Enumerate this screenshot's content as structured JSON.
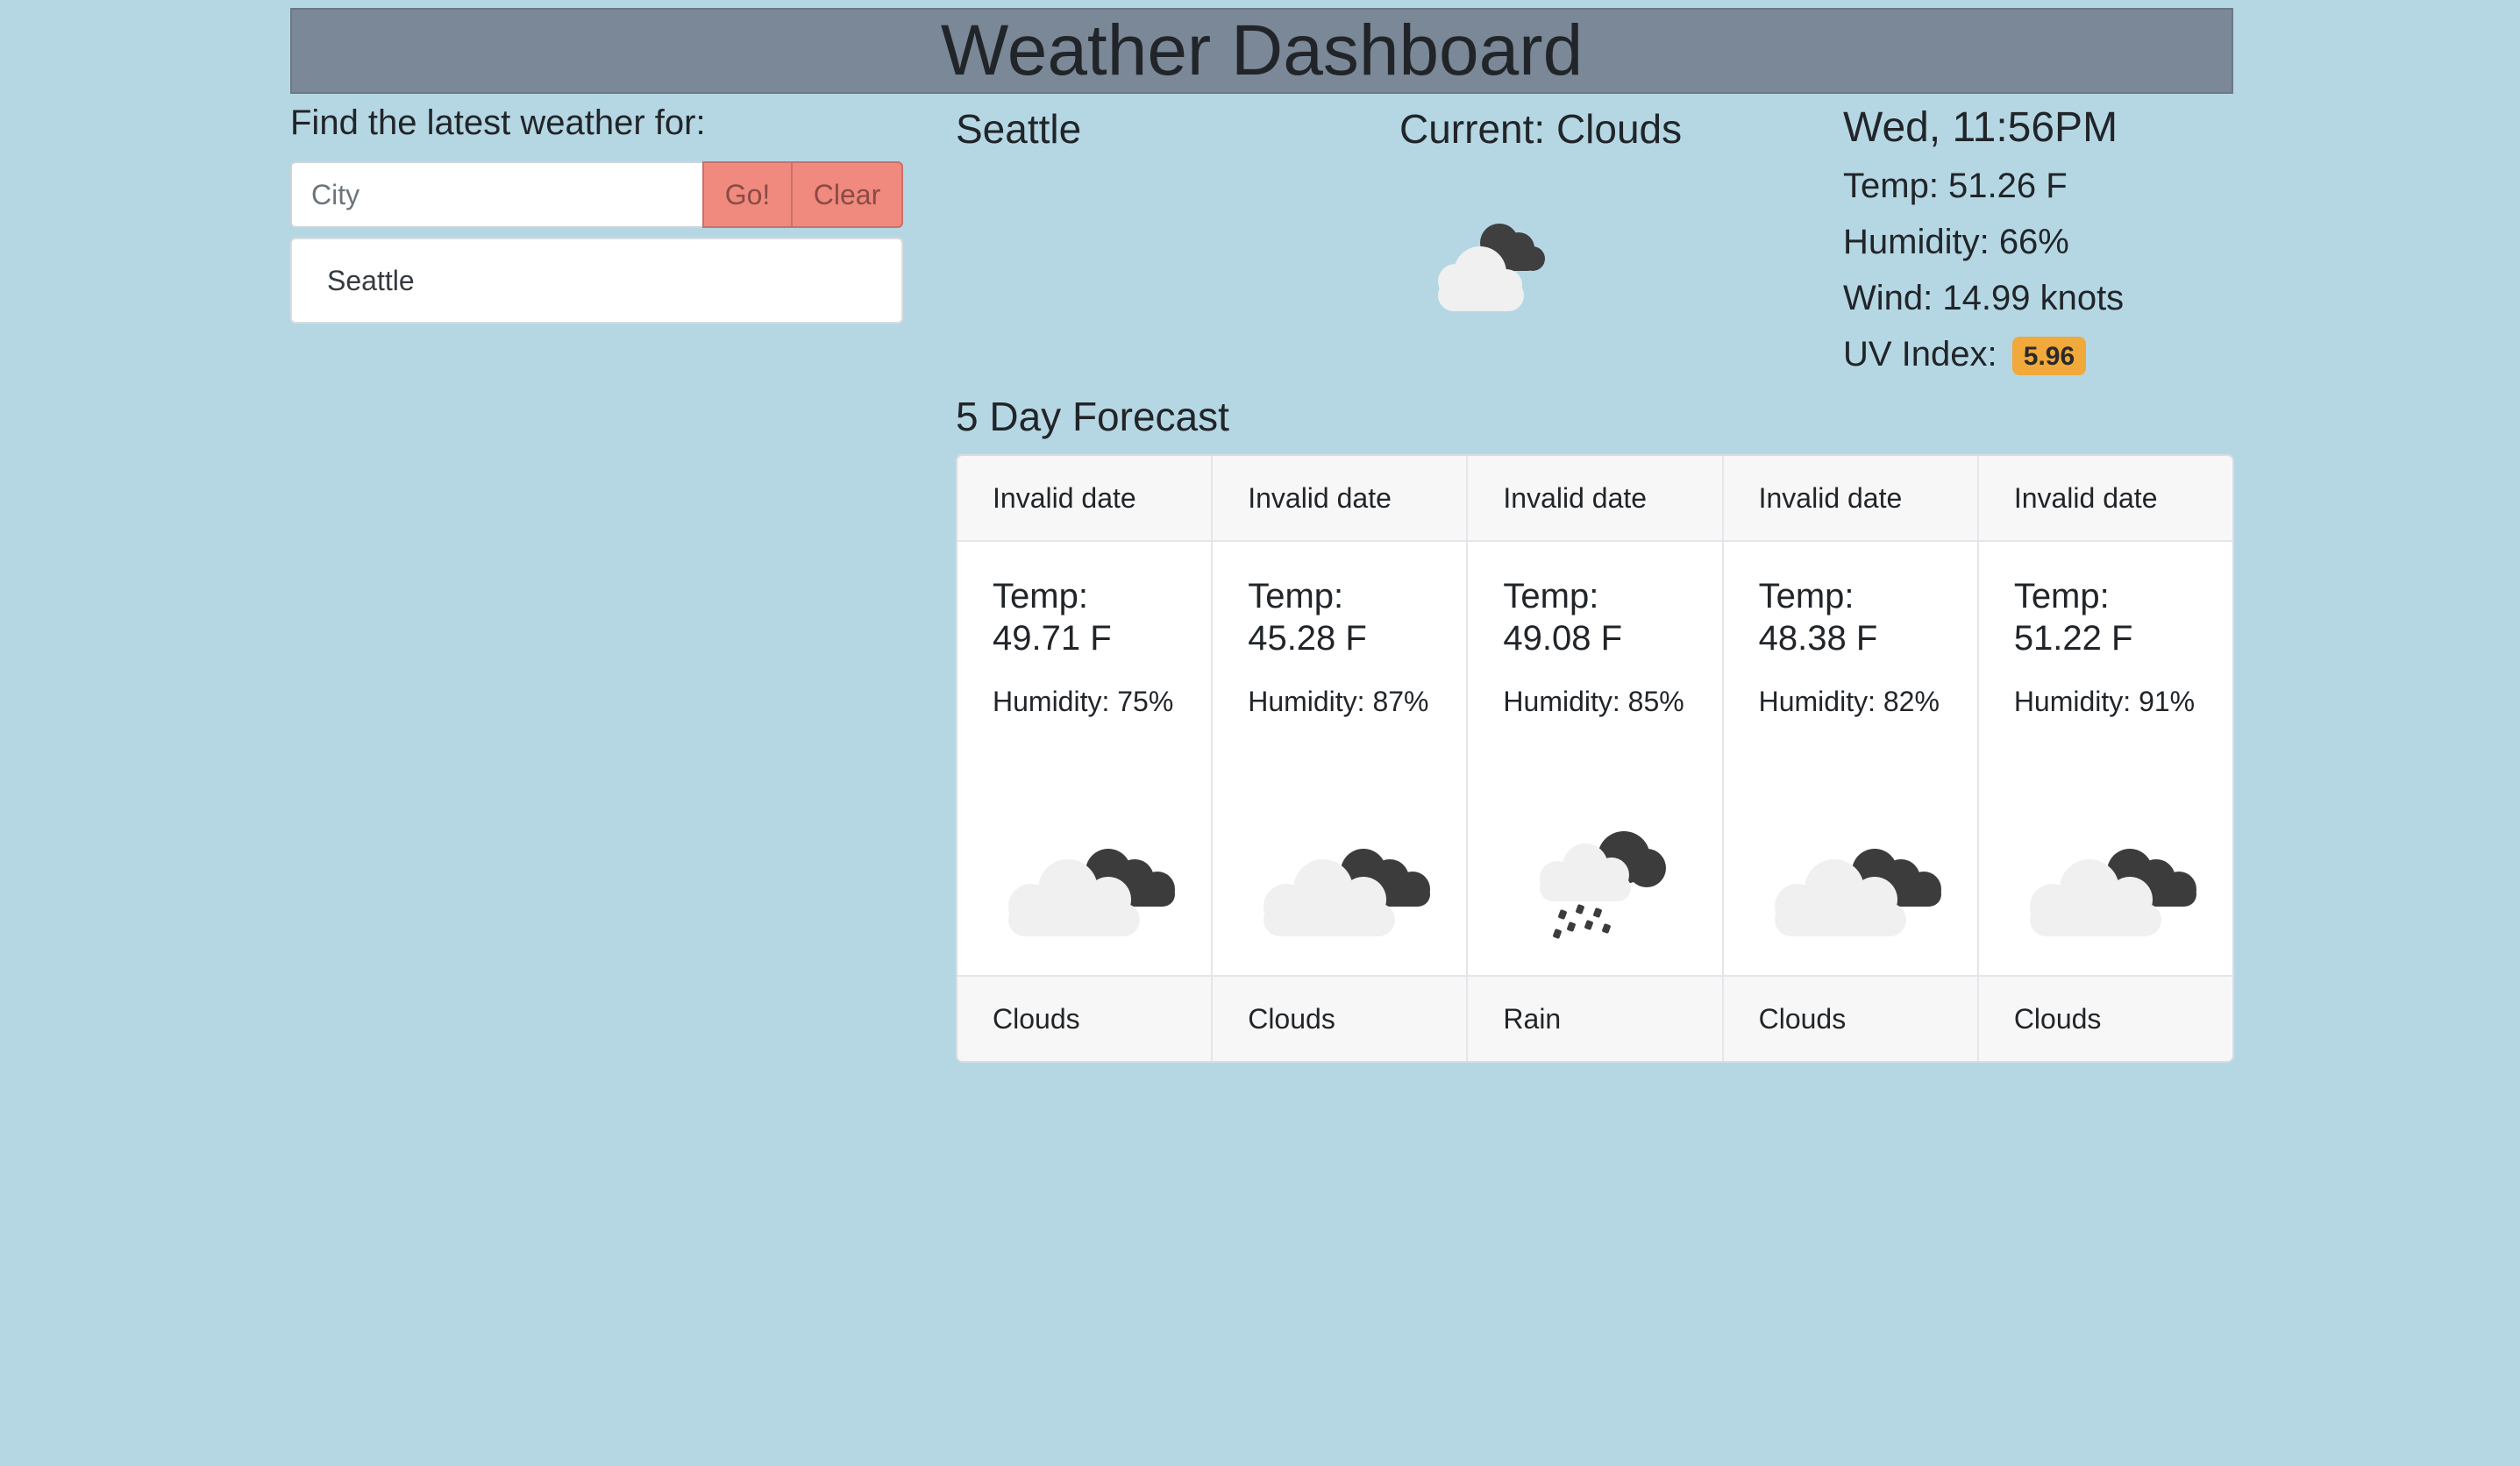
{
  "header": {
    "title": "Weather Dashboard"
  },
  "search": {
    "label": "Find the latest weather for:",
    "placeholder": "City",
    "go_label": "Go!",
    "clear_label": "Clear",
    "history": [
      "Seattle"
    ]
  },
  "current": {
    "city": "Seattle",
    "condition": "Current: Clouds",
    "icon": "clouds-icon",
    "datetime": "Wed, 11:56PM",
    "temp": "Temp: 51.26 F",
    "humidity": "Humidity: 66%",
    "wind": "Wind: 14.99 knots",
    "uv_label": "UV Index:",
    "uv_value": "5.96",
    "uv_color": "#f0a93a"
  },
  "forecast": {
    "title": "5 Day Forecast",
    "days": [
      {
        "date": "Invalid date",
        "temp_label": "Temp:",
        "temp": "49.71 F",
        "humidity": "Humidity: 75%",
        "icon": "clouds-icon",
        "condition": "Clouds"
      },
      {
        "date": "Invalid date",
        "temp_label": "Temp:",
        "temp": "45.28 F",
        "humidity": "Humidity: 87%",
        "icon": "clouds-icon",
        "condition": "Clouds"
      },
      {
        "date": "Invalid date",
        "temp_label": "Temp:",
        "temp": "49.08 F",
        "humidity": "Humidity: 85%",
        "icon": "rain-icon",
        "condition": "Rain"
      },
      {
        "date": "Invalid date",
        "temp_label": "Temp:",
        "temp": "48.38 F",
        "humidity": "Humidity: 82%",
        "icon": "clouds-icon",
        "condition": "Clouds"
      },
      {
        "date": "Invalid date",
        "temp_label": "Temp:",
        "temp": "51.22 F",
        "humidity": "Humidity: 91%",
        "icon": "clouds-icon",
        "condition": "Clouds"
      }
    ]
  }
}
